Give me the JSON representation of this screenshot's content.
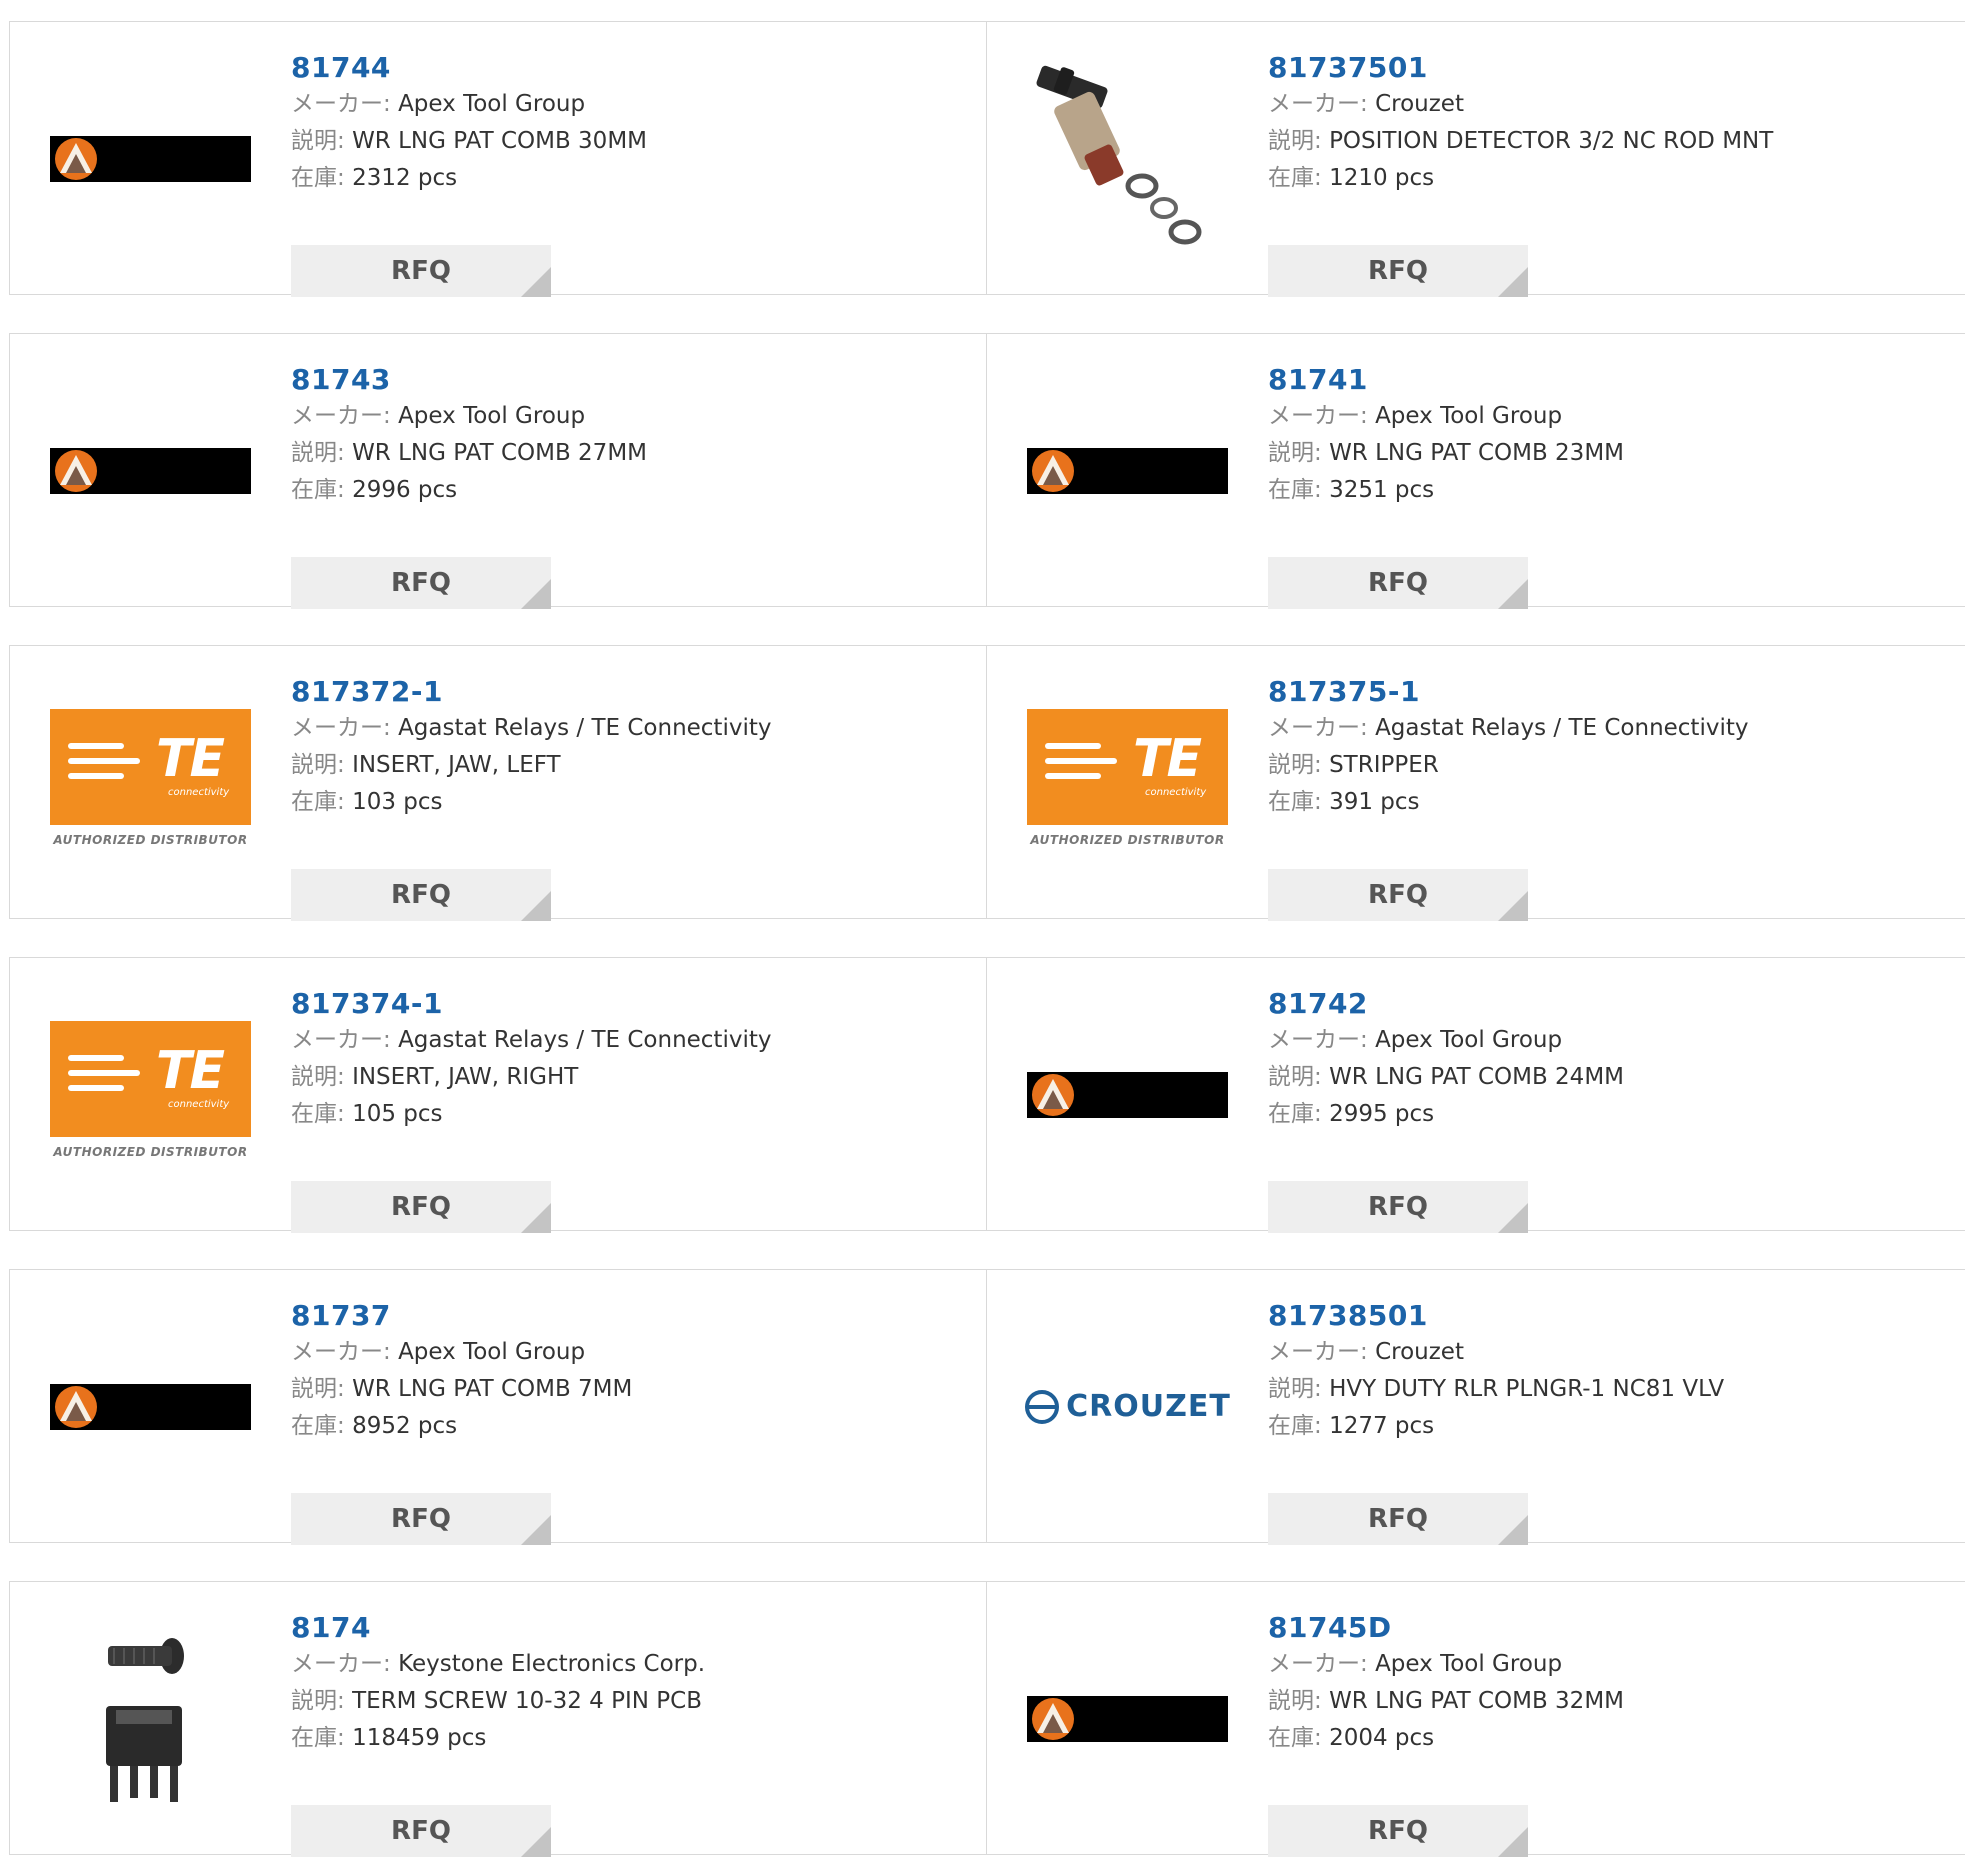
{
  "labels": {
    "maker": "メーカー:",
    "desc": "説明:",
    "stock": "在庫:",
    "rfq": "RFQ"
  },
  "logos": {
    "te_sub": "connectivity",
    "te_auth": "AUTHORIZED DISTRIBUTOR",
    "crouzet": "CROUZET"
  },
  "products": [
    {
      "pn": "81744",
      "maker": "Apex Tool Group",
      "desc": "WR LNG PAT COMB 30MM",
      "stock": "2312 pcs",
      "image": "apex-logo"
    },
    {
      "pn": "81737501",
      "maker": "Crouzet",
      "desc": "POSITION DETECTOR 3/2 NC ROD MNT",
      "stock": "1210 pcs",
      "image": "position-detector-photo"
    },
    {
      "pn": "81743",
      "maker": "Apex Tool Group",
      "desc": "WR LNG PAT COMB 27MM",
      "stock": "2996 pcs",
      "image": "apex-logo"
    },
    {
      "pn": "81741",
      "maker": "Apex Tool Group",
      "desc": "WR LNG PAT COMB 23MM",
      "stock": "3251 pcs",
      "image": "apex-logo"
    },
    {
      "pn": "817372-1",
      "maker": "Agastat Relays / TE Connectivity",
      "desc": "INSERT, JAW, LEFT",
      "stock": "103 pcs",
      "image": "te-logo"
    },
    {
      "pn": "817375-1",
      "maker": "Agastat Relays / TE Connectivity",
      "desc": "STRIPPER",
      "stock": "391 pcs",
      "image": "te-logo"
    },
    {
      "pn": "817374-1",
      "maker": "Agastat Relays / TE Connectivity",
      "desc": "INSERT, JAW, RIGHT",
      "stock": "105 pcs",
      "image": "te-logo"
    },
    {
      "pn": "81742",
      "maker": "Apex Tool Group",
      "desc": "WR LNG PAT COMB 24MM",
      "stock": "2995 pcs",
      "image": "apex-logo"
    },
    {
      "pn": "81737",
      "maker": "Apex Tool Group",
      "desc": "WR LNG PAT COMB 7MM",
      "stock": "8952 pcs",
      "image": "apex-logo"
    },
    {
      "pn": "81738501",
      "maker": "Crouzet",
      "desc": "HVY DUTY RLR PLNGR-1 NC81 VLV",
      "stock": "1277 pcs",
      "image": "crouzet-logo"
    },
    {
      "pn": "8174",
      "maker": "Keystone Electronics Corp.",
      "desc": "TERM SCREW 10-32 4 PIN PCB",
      "stock": "118459 pcs",
      "image": "term-screw-photo"
    },
    {
      "pn": "81745D",
      "maker": "Apex Tool Group",
      "desc": "WR LNG PAT COMB 32MM",
      "stock": "2004 pcs",
      "image": "apex-logo"
    }
  ]
}
